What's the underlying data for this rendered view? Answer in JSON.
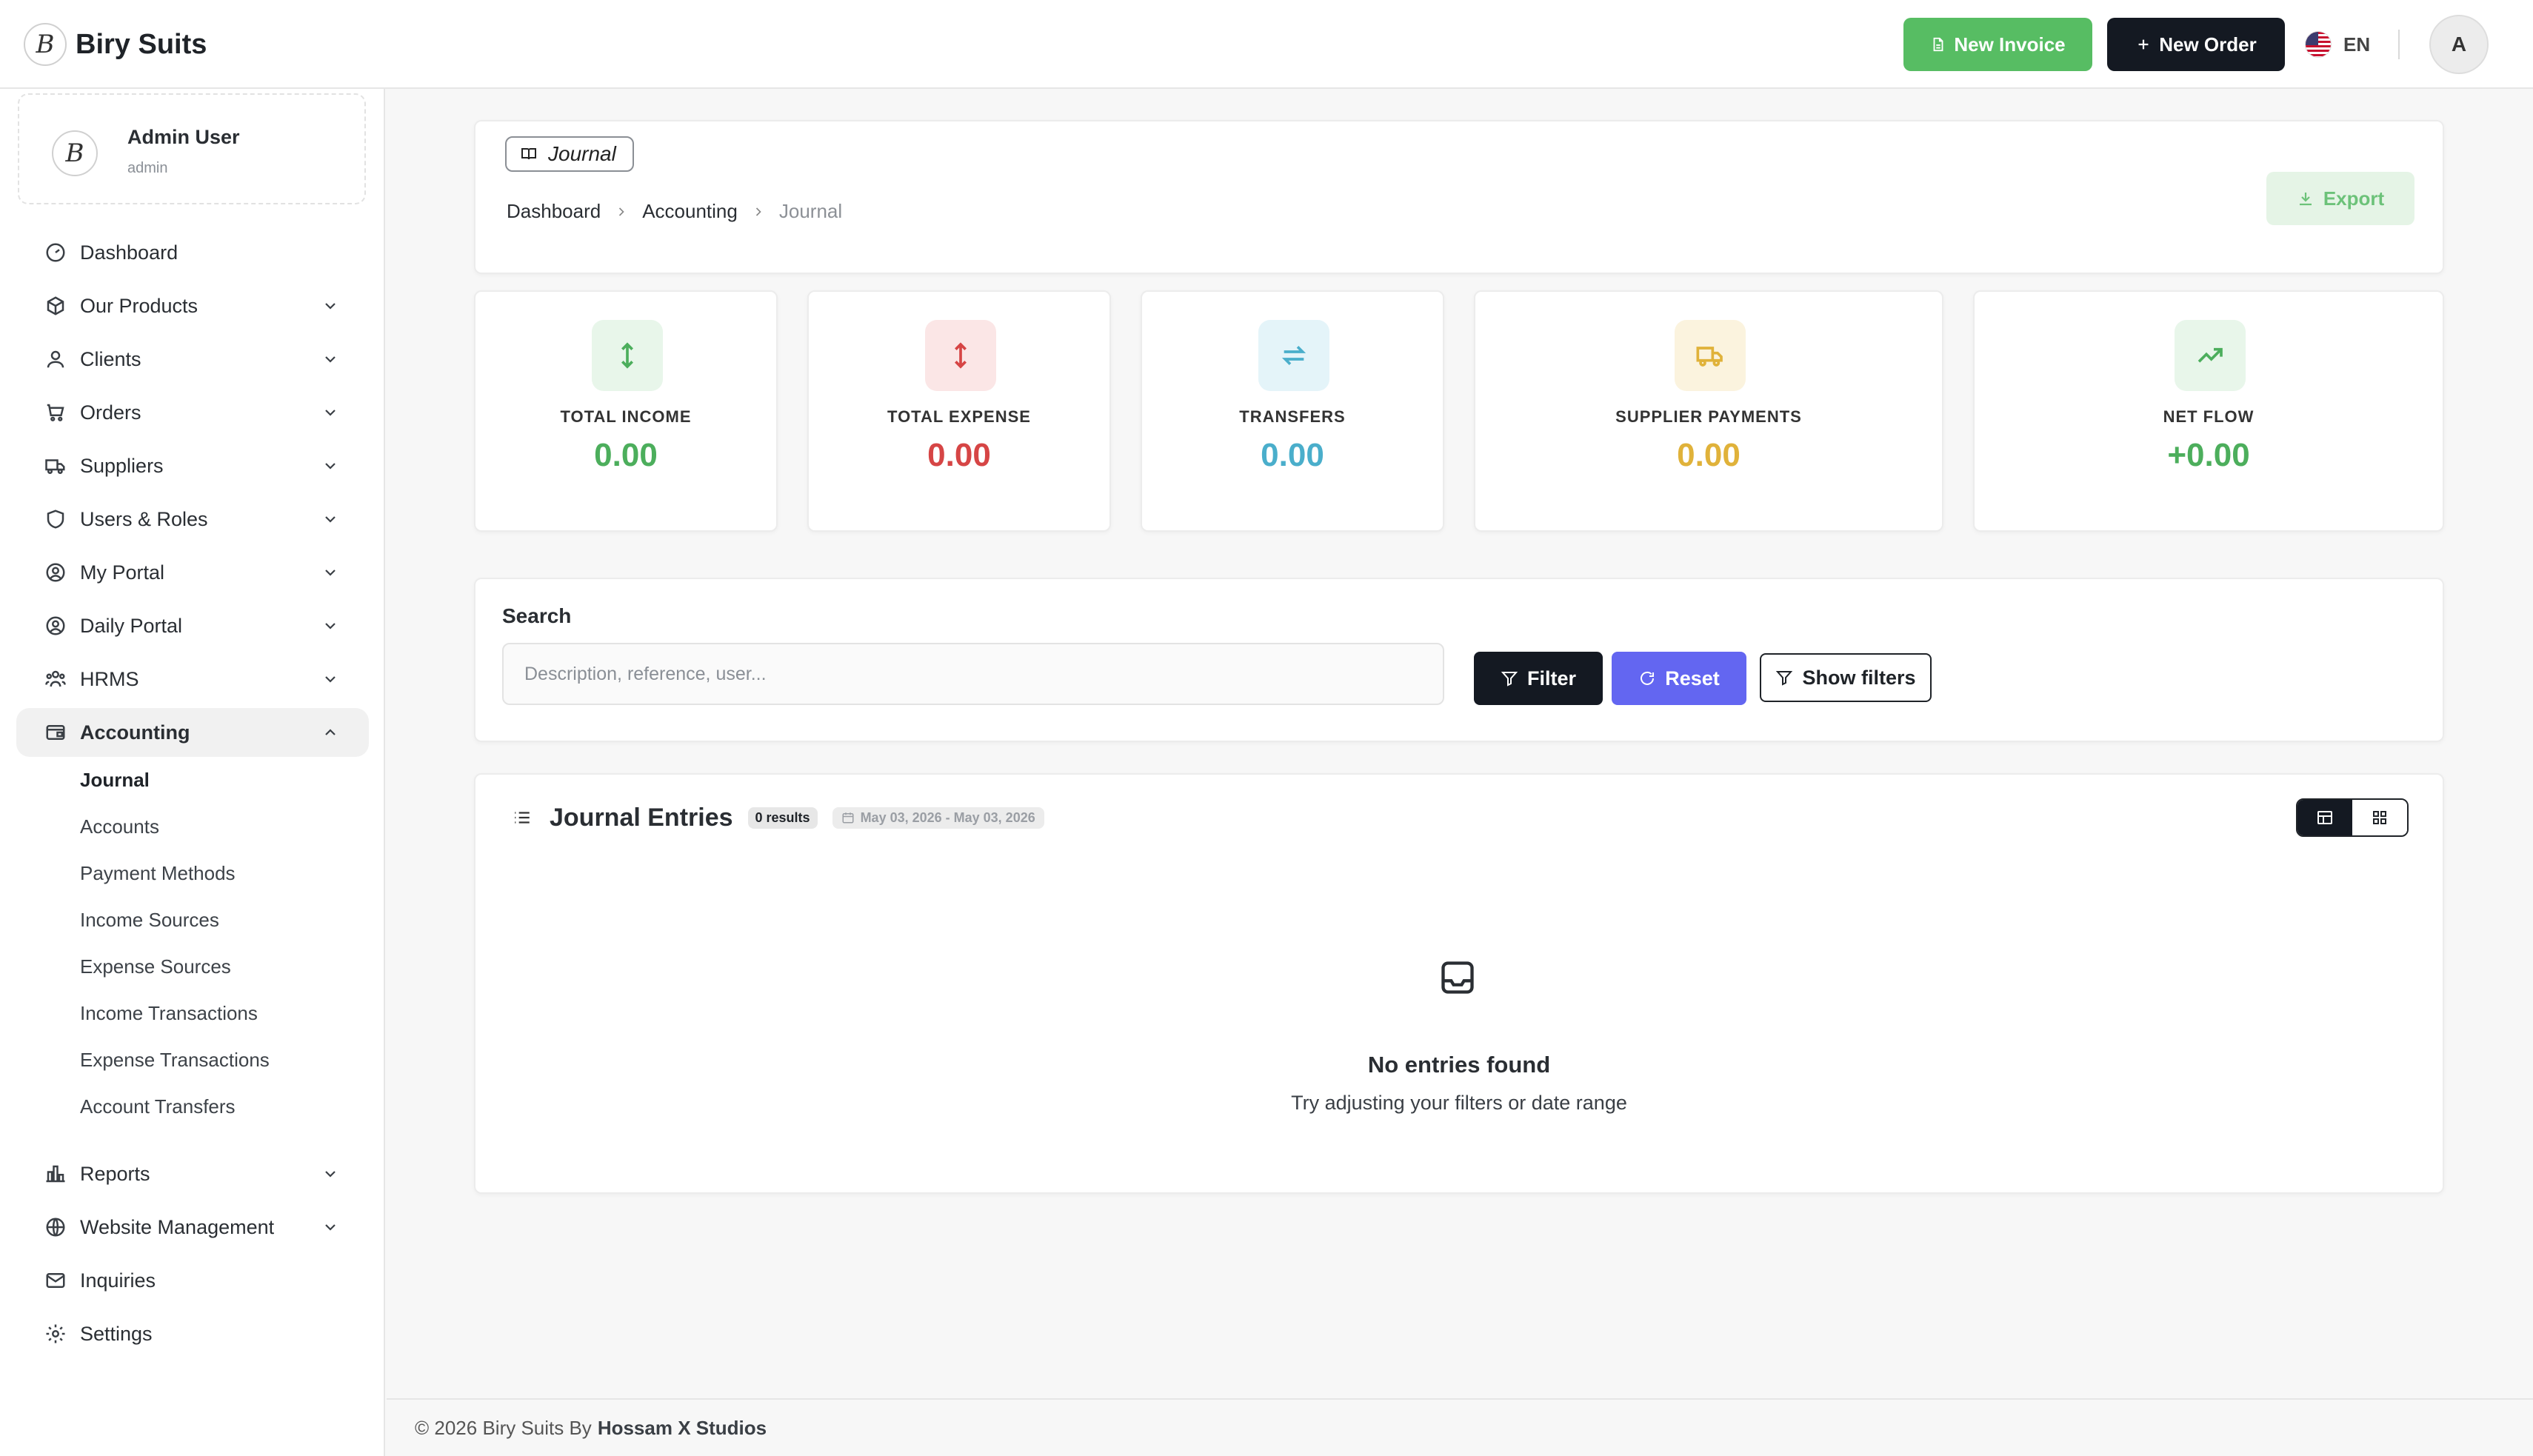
{
  "app": {
    "brand": "Biry Suits",
    "logo_letter": "B"
  },
  "topbar": {
    "new_invoice": "New Invoice",
    "new_order": "New Order",
    "language": "EN",
    "avatar_initial": "A",
    "new_invoice_color": "#57bd63",
    "new_order_color": "#141922"
  },
  "user": {
    "name": "Admin User",
    "role": "admin"
  },
  "sidebar": {
    "items": [
      {
        "label": "Dashboard",
        "icon": "dashboard-icon"
      },
      {
        "label": "Our Products",
        "icon": "box-icon"
      },
      {
        "label": "Clients",
        "icon": "user-icon"
      },
      {
        "label": "Orders",
        "icon": "cart-icon"
      },
      {
        "label": "Suppliers",
        "icon": "truck-icon"
      },
      {
        "label": "Users & Roles",
        "icon": "shield-icon"
      },
      {
        "label": "My Portal",
        "icon": "user-circle-icon"
      },
      {
        "label": "Daily Portal",
        "icon": "user-circle-icon"
      },
      {
        "label": "HRMS",
        "icon": "users-icon"
      },
      {
        "label": "Accounting",
        "icon": "wallet-icon"
      },
      {
        "label": "Reports",
        "icon": "bar-chart-icon"
      },
      {
        "label": "Website Management",
        "icon": "globe-icon"
      },
      {
        "label": "Inquiries",
        "icon": "mail-icon"
      },
      {
        "label": "Settings",
        "icon": "gear-icon"
      }
    ],
    "accounting_sub": [
      "Journal",
      "Accounts",
      "Payment Methods",
      "Income Sources",
      "Expense Sources",
      "Income Transactions",
      "Expense Transactions",
      "Account Transfers"
    ],
    "active_item": "Accounting",
    "active_sub": "Journal"
  },
  "header": {
    "page_chip": "Journal",
    "breadcrumb": [
      "Dashboard",
      "Accounting",
      "Journal"
    ],
    "export_label": "Export"
  },
  "stats": [
    {
      "label": "TOTAL INCOME",
      "value": "0.00",
      "color": "#4cae5c",
      "bg": "#e8f6ea",
      "icon": "arrow-up-down-icon"
    },
    {
      "label": "TOTAL EXPENSE",
      "value": "0.00",
      "color": "#d64545",
      "bg": "#fbe6e6",
      "icon": "arrow-up-down-icon"
    },
    {
      "label": "TRANSFERS",
      "value": "0.00",
      "color": "#4aaecb",
      "bg": "#e4f4f9",
      "icon": "transfer-icon"
    },
    {
      "label": "SUPPLIER PAYMENTS",
      "value": "0.00",
      "color": "#e0b23a",
      "bg": "#fbf3de",
      "icon": "truck-icon"
    },
    {
      "label": "NET FLOW",
      "value": "+0.00",
      "color": "#4cae5c",
      "bg": "#e8f6ea",
      "icon": "trending-up-icon"
    }
  ],
  "search": {
    "title": "Search",
    "placeholder": "Description, reference, user...",
    "filter_label": "Filter",
    "reset_label": "Reset",
    "show_filters_label": "Show filters"
  },
  "entries": {
    "title": "Journal Entries",
    "count_badge": "0 results",
    "date_range": "May 03, 2026 - May 03, 2026",
    "empty_title": "No entries found",
    "empty_subtitle": "Try adjusting your filters or date range"
  },
  "footer": {
    "text": "© 2026 Biry Suits By",
    "company": "Hossam X Studios"
  }
}
